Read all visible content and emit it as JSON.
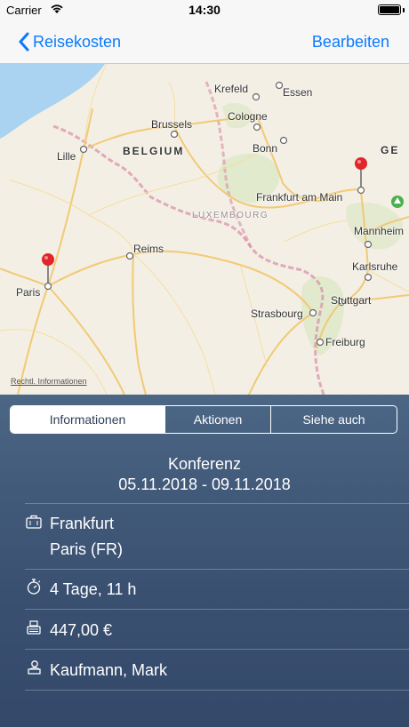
{
  "status_bar": {
    "carrier": "Carrier",
    "time": "14:30"
  },
  "nav": {
    "back_label": "Reisekosten",
    "edit_label": "Bearbeiten"
  },
  "map": {
    "cities": {
      "krefeld": "Krefeld",
      "essen": "Essen",
      "brussels": "Brussels",
      "cologne": "Cologne",
      "lille": "Lille",
      "bonn": "Bonn",
      "frankfurt": "Frankfurt am Main",
      "mannheim": "Mannheim",
      "reims": "Reims",
      "karlsruhe": "Karlsruhe",
      "paris": "Paris",
      "stuttgart": "Stuttgart",
      "strasbourg": "Strasbourg",
      "freiburg": "Freiburg"
    },
    "countries": {
      "belgium": "BELGIUM",
      "germany_partial": "GE"
    },
    "regions": {
      "luxembourg": "LUXEMBOURG"
    },
    "legal_link": "Rechtl. Informationen",
    "pin_color": "#e0262b"
  },
  "tabs": [
    {
      "label": "Informationen",
      "selected": true
    },
    {
      "label": "Aktionen",
      "selected": false
    },
    {
      "label": "Siehe auch",
      "selected": false
    }
  ],
  "event": {
    "type": "Konferenz",
    "dates": "05.11.2018 - 09.11.2018"
  },
  "details": {
    "origin": "Frankfurt",
    "destination": "Paris (FR)",
    "duration": "4 Tage, 11 h",
    "amount": "447,00 €",
    "person": "Kaufmann, Mark"
  },
  "colors": {
    "accent": "#0a7aff",
    "panel": "#425a79"
  }
}
